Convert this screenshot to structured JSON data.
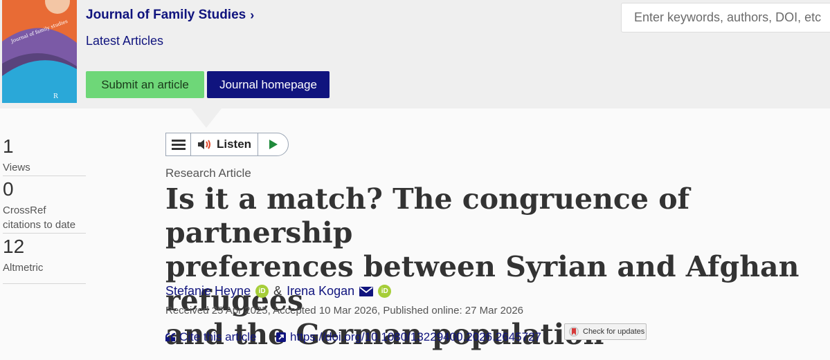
{
  "header": {
    "journal_title": "Journal of Family Studies",
    "latest_articles": "Latest Articles",
    "submit_label": "Submit an article",
    "homepage_label": "Journal homepage",
    "cover_title": "Journal of family studies",
    "search_placeholder": "Enter keywords, authors, DOI, etc"
  },
  "player": {
    "listen_label": "Listen"
  },
  "metrics": [
    {
      "value": "1",
      "label": "Views"
    },
    {
      "value": "0",
      "label_line1": "CrossRef",
      "label_line2": "citations to date"
    },
    {
      "value": "12",
      "label": "Altmetric"
    }
  ],
  "article": {
    "type": "Research Article",
    "title_line1": "Is it a match? The congruence of partnership",
    "title_line2": "preferences between Syrian and Afghan refugees",
    "title_line3": "and the German population",
    "author1": "Stefanie Heyne",
    "author2": "Irena Kogan",
    "separator": "&",
    "dates": "Received 25 Apr 2025, Accepted 10 Mar 2026, Published online: 27 Mar 2026",
    "cite_label": "Cite this article",
    "doi": "https://doi.org/10.1080/13229400.2026.2645727",
    "check_updates": "Check for updates"
  },
  "colors": {
    "brand_navy": "#10147e",
    "submit_green": "#6ed778",
    "orcid_green": "#a6ce39",
    "header_bg": "#efefef"
  }
}
